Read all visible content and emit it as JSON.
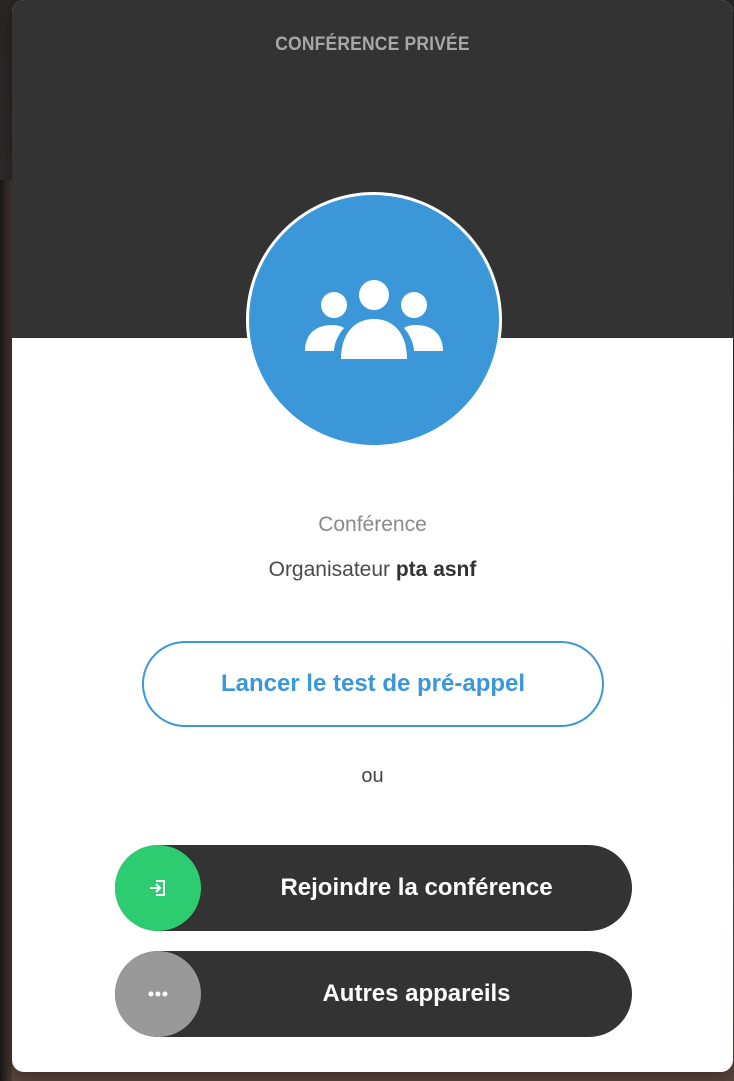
{
  "dialog": {
    "title": "CONFÉRENCE PRIVÉE",
    "avatar_icon": "group-icon",
    "conference_label": "Conférence",
    "organizer_prefix": "Organisateur",
    "organizer_name": "pta asnf"
  },
  "actions": {
    "pre_call_test_label": "Lancer le test de pré-appel",
    "or_label": "ou",
    "join_label": "Rejoindre la conférence",
    "join_icon": "sign-in-icon",
    "other_devices_label": "Autres appareils",
    "other_devices_icon": "more-dots-icon"
  },
  "colors": {
    "header": "#333333",
    "accent_blue": "#3b97d8",
    "join_green": "#2ecc71",
    "other_grey": "#999999"
  }
}
